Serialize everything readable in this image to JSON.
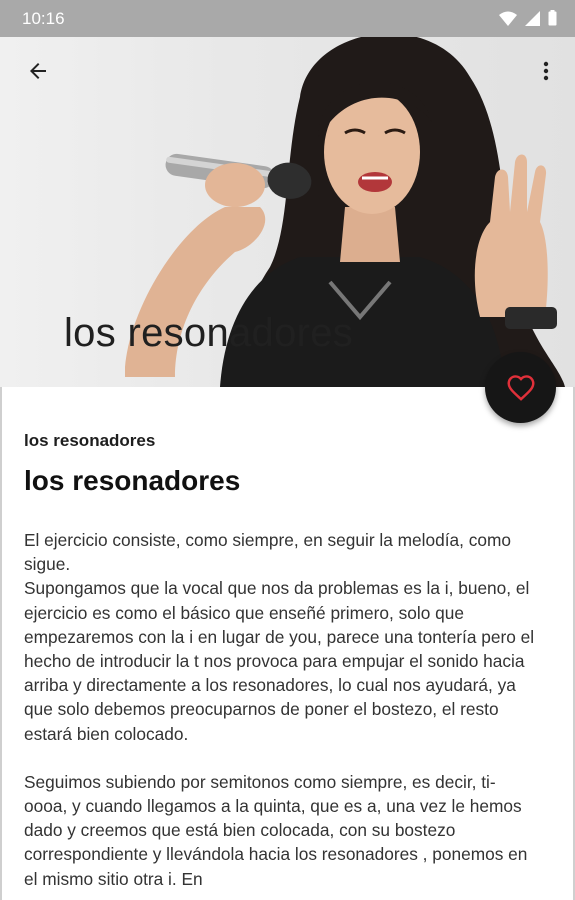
{
  "status_bar": {
    "time": "10:16",
    "icons": [
      "wifi-icon",
      "cellular-icon",
      "battery-icon"
    ]
  },
  "toolbar": {
    "back_icon": "arrow-back-icon",
    "more_icon": "more-vert-icon"
  },
  "hero": {
    "image": "woman singing into microphone",
    "title": "los resonadores"
  },
  "fab": {
    "icon": "heart-outline-icon",
    "accent": "#e0303a"
  },
  "article": {
    "subtitle": "los resonadores",
    "title": "los resonadores",
    "paragraphs": [
      "El ejercicio consiste, como siempre, en seguir la melodía, como sigue.\nSupongamos que la vocal que nos da problemas es la i, bueno, el ejercicio es como el básico que enseñé primero, solo que empezaremos con la i en lugar de you, parece una tontería pero el hecho de introducir la t nos provoca para empujar el sonido hacia arriba y directamente a los resonadores, lo cual nos ayudará, ya que solo debemos preocuparnos de poner el bostezo, el resto estará bien colocado.",
      "Seguimos subiendo por semitonos como siempre, es decir, ti-oooa, y cuando llegamos a la quinta, que es a, una vez le hemos dado y creemos que está bien colocada, con su bostezo correspondiente y llevándola hacia los resonadores , ponemos en el mismo sitio otra i. En"
    ]
  },
  "colors": {
    "status_bar": "#a9a9a9",
    "fab_background": "#161616"
  }
}
